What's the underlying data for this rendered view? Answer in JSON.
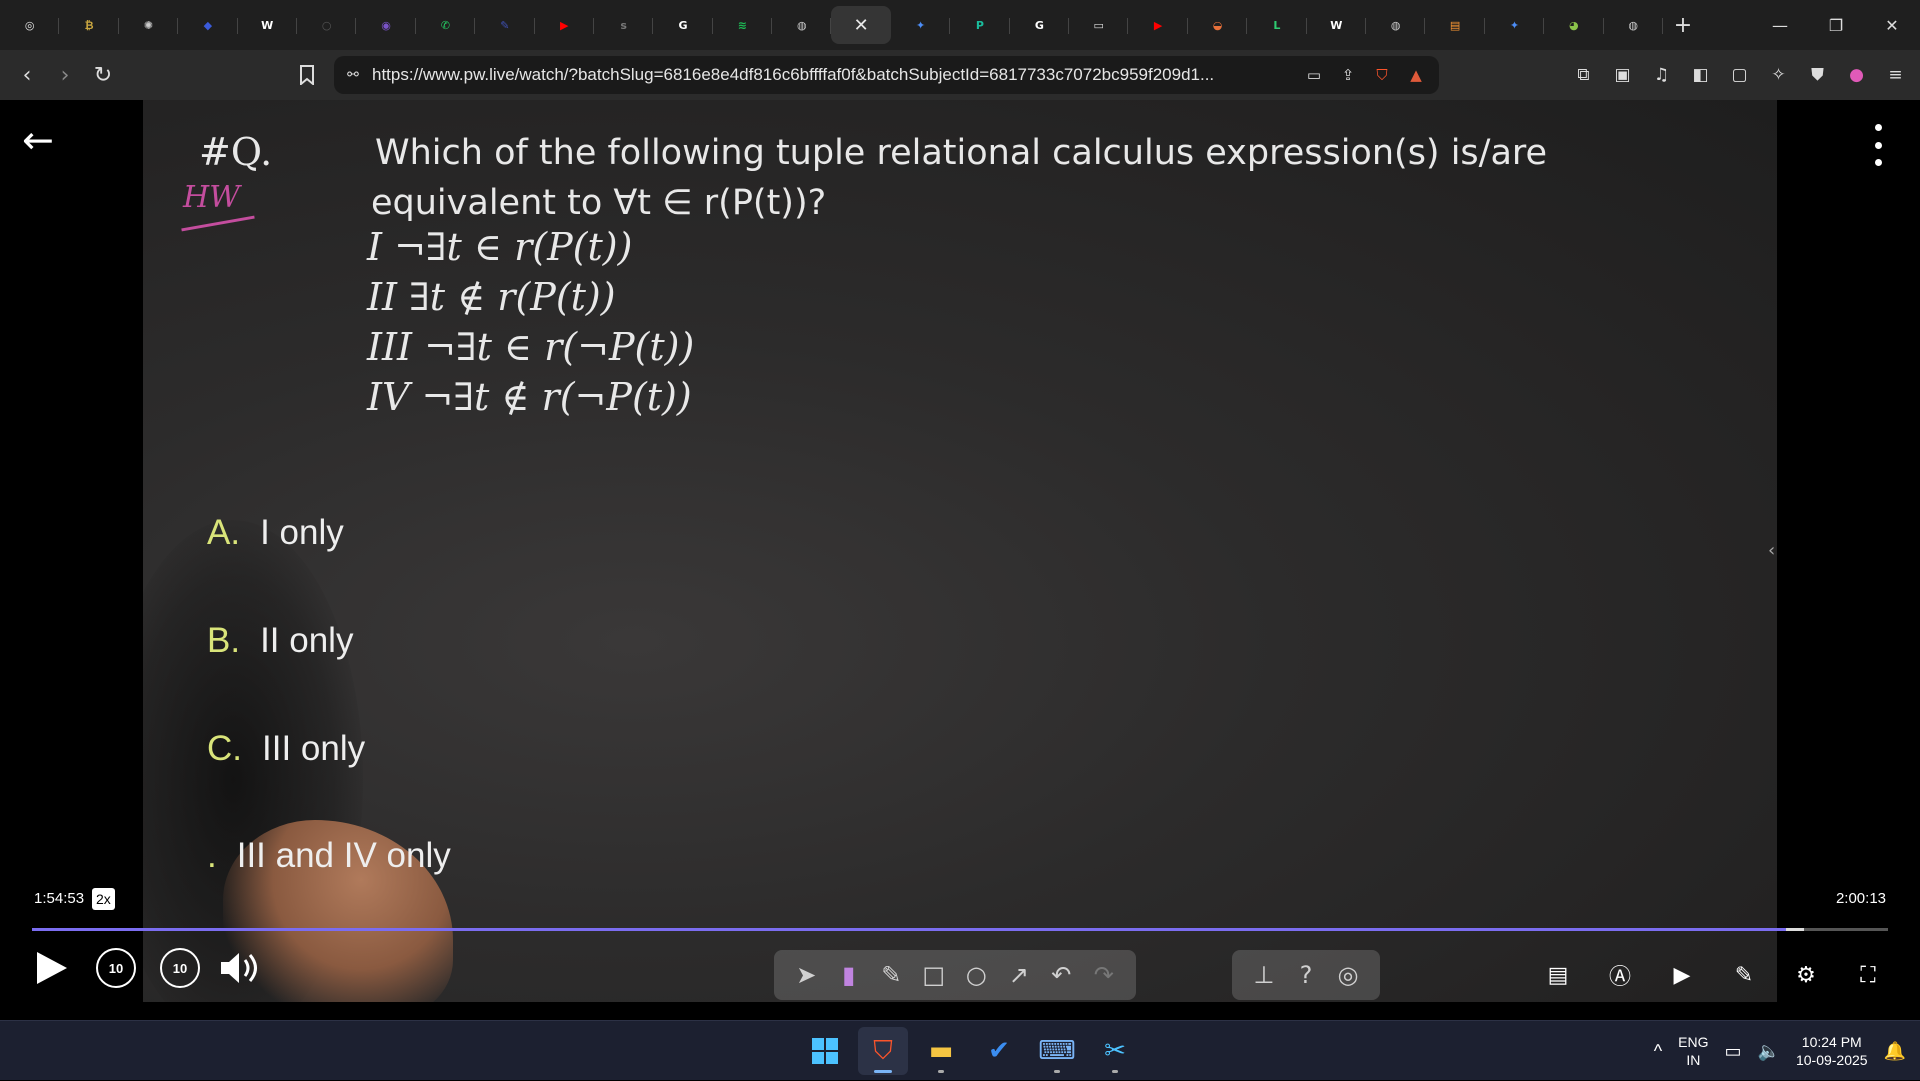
{
  "browser": {
    "tabs": [
      {
        "icon": "chatgpt-icon",
        "color": "#e8e8e8",
        "glyph": "◎"
      },
      {
        "icon": "coin-icon",
        "color": "#c9a640",
        "glyph": "₿"
      },
      {
        "icon": "openai-icon",
        "color": "#cccccc",
        "glyph": "✺"
      },
      {
        "icon": "code-icon",
        "color": "#3b5bdb",
        "glyph": "◆"
      },
      {
        "icon": "w3schools-icon",
        "color": "#ffffff",
        "glyph": "W"
      },
      {
        "icon": "placeholder-icon",
        "color": "#555555",
        "glyph": "○"
      },
      {
        "icon": "perplexity-icon",
        "color": "#7a53c9",
        "glyph": "◉"
      },
      {
        "icon": "whatsapp-icon",
        "color": "#25d366",
        "glyph": "✆"
      },
      {
        "icon": "pen-icon",
        "color": "#3f51b5",
        "glyph": "✎"
      },
      {
        "icon": "youtube-icon",
        "color": "#ff0000",
        "glyph": "▶"
      },
      {
        "icon": "scrip-icon",
        "color": "#777777",
        "glyph": "s"
      },
      {
        "icon": "google-icon",
        "color": "#ffffff",
        "glyph": "G"
      },
      {
        "icon": "spotify-icon",
        "color": "#1db954",
        "glyph": "≋"
      },
      {
        "icon": "globe-icon",
        "color": "#cccccc",
        "glyph": "◍"
      },
      {
        "icon": "close-tab-icon",
        "color": "#e8e8e8",
        "glyph": "✕",
        "active": true
      },
      {
        "icon": "gemini-icon",
        "color": "#4c8df6",
        "glyph": "✦"
      },
      {
        "icon": "pw-icon",
        "color": "#1abc9c",
        "glyph": "P"
      },
      {
        "icon": "google-icon",
        "color": "#ffffff",
        "glyph": "G"
      },
      {
        "icon": "screen-icon",
        "color": "#dddddd",
        "glyph": "▭"
      },
      {
        "icon": "youtube-icon",
        "color": "#ff0000",
        "glyph": "▶"
      },
      {
        "icon": "planet-icon",
        "color": "#e8703a",
        "glyph": "◒"
      },
      {
        "icon": "leetcode-icon",
        "color": "#2ecc71",
        "glyph": "L"
      },
      {
        "icon": "wikipedia-icon",
        "color": "#ffffff",
        "glyph": "W"
      },
      {
        "icon": "globe-icon",
        "color": "#cccccc",
        "glyph": "◍"
      },
      {
        "icon": "india-flag-icon",
        "color": "#ff9933",
        "glyph": "▤"
      },
      {
        "icon": "gemini-icon",
        "color": "#4c8df6",
        "glyph": "✦"
      },
      {
        "icon": "app-icon",
        "color": "#8bc34a",
        "glyph": "◕"
      },
      {
        "icon": "globe-icon",
        "color": "#cccccc",
        "glyph": "◍"
      }
    ],
    "new_tab": "+",
    "window": {
      "minimize": "—",
      "restore": "❐",
      "close": "✕"
    },
    "url": "https://www.pw.live/watch/?batchSlug=6816e8e4df816c6bffffaf0f&batchSubjectId=6817733c7072bc959f209d1...",
    "shield_count": "1"
  },
  "question": {
    "number": "#Q.",
    "hw": "HW",
    "line1": "Which of the following tuple relational calculus expression(s) is/are",
    "line2": "equivalent to ∀t ∈ r(P(t))?",
    "expr": [
      "I ¬∃t ∈ r(P(t))",
      "II ∃t ∉ r(P(t))",
      "III ¬∃t ∈ r(¬P(t))",
      "IV ¬∃t ∉ r(¬P(t))"
    ]
  },
  "options": [
    {
      "letter": "A.",
      "text": "I only"
    },
    {
      "letter": "B.",
      "text": "II only"
    },
    {
      "letter": "C.",
      "text": "III only"
    },
    {
      "letter": ".",
      "text": "III and IV only"
    }
  ],
  "player": {
    "current_time": "1:54:53",
    "speed": "2x",
    "total_time": "2:00:13",
    "progress": 0.945,
    "buffered": 0.955,
    "skip_back": "10",
    "skip_forward": "10",
    "accent": "#7b6df0"
  },
  "taskbar": {
    "lang_top": "ENG",
    "lang_bottom": "IN",
    "time": "10:24 PM",
    "date": "10-09-2025"
  }
}
